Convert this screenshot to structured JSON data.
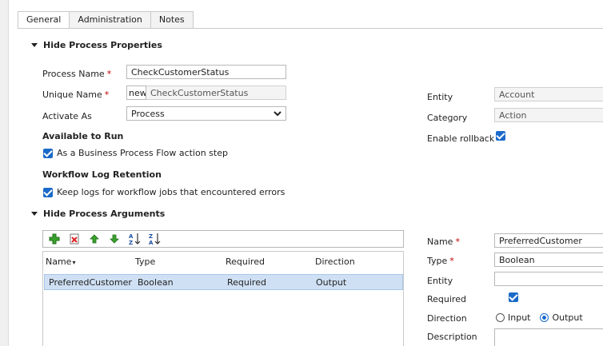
{
  "tabs": [
    "General",
    "Administration",
    "Notes"
  ],
  "properties": {
    "heading": "Hide Process Properties",
    "process_name_label": "Process Name",
    "process_name_value": "CheckCustomerStatus",
    "unique_name_label": "Unique Name",
    "unique_name_prefix": "new_",
    "unique_name_value": "CheckCustomerStatus",
    "activate_as_label": "Activate As",
    "activate_as_value": "Process",
    "entity_label": "Entity",
    "entity_value": "Account",
    "category_label": "Category",
    "category_value": "Action",
    "enable_rollback_label": "Enable rollback",
    "available_heading": "Available to Run",
    "bpf_label": "As a Business Process Flow action step",
    "log_heading": "Workflow Log Retention",
    "log_label": "Keep logs for workflow jobs that encountered errors"
  },
  "arguments": {
    "heading": "Hide Process Arguments",
    "toolbar_icons": [
      "add-icon",
      "delete-icon",
      "move-up-icon",
      "move-down-icon",
      "sort-ascending-icon",
      "sort-descending-icon"
    ],
    "columns": [
      "Name",
      "Type",
      "Required",
      "Direction"
    ],
    "rows": [
      {
        "name": "PreferredCustomer",
        "type": "Boolean",
        "required": "Required",
        "direction": "Output"
      }
    ]
  },
  "details": {
    "name_label": "Name",
    "name_value": "PreferredCustomer",
    "type_label": "Type",
    "type_value": "Boolean",
    "entity_label": "Entity",
    "entity_value": "",
    "required_label": "Required",
    "direction_label": "Direction",
    "direction_input": "Input",
    "direction_output": "Output",
    "description_label": "Description"
  },
  "colors": {
    "accent": "#1b6ac9",
    "required": "#c00000",
    "selected_row": "#cfe0f4"
  }
}
